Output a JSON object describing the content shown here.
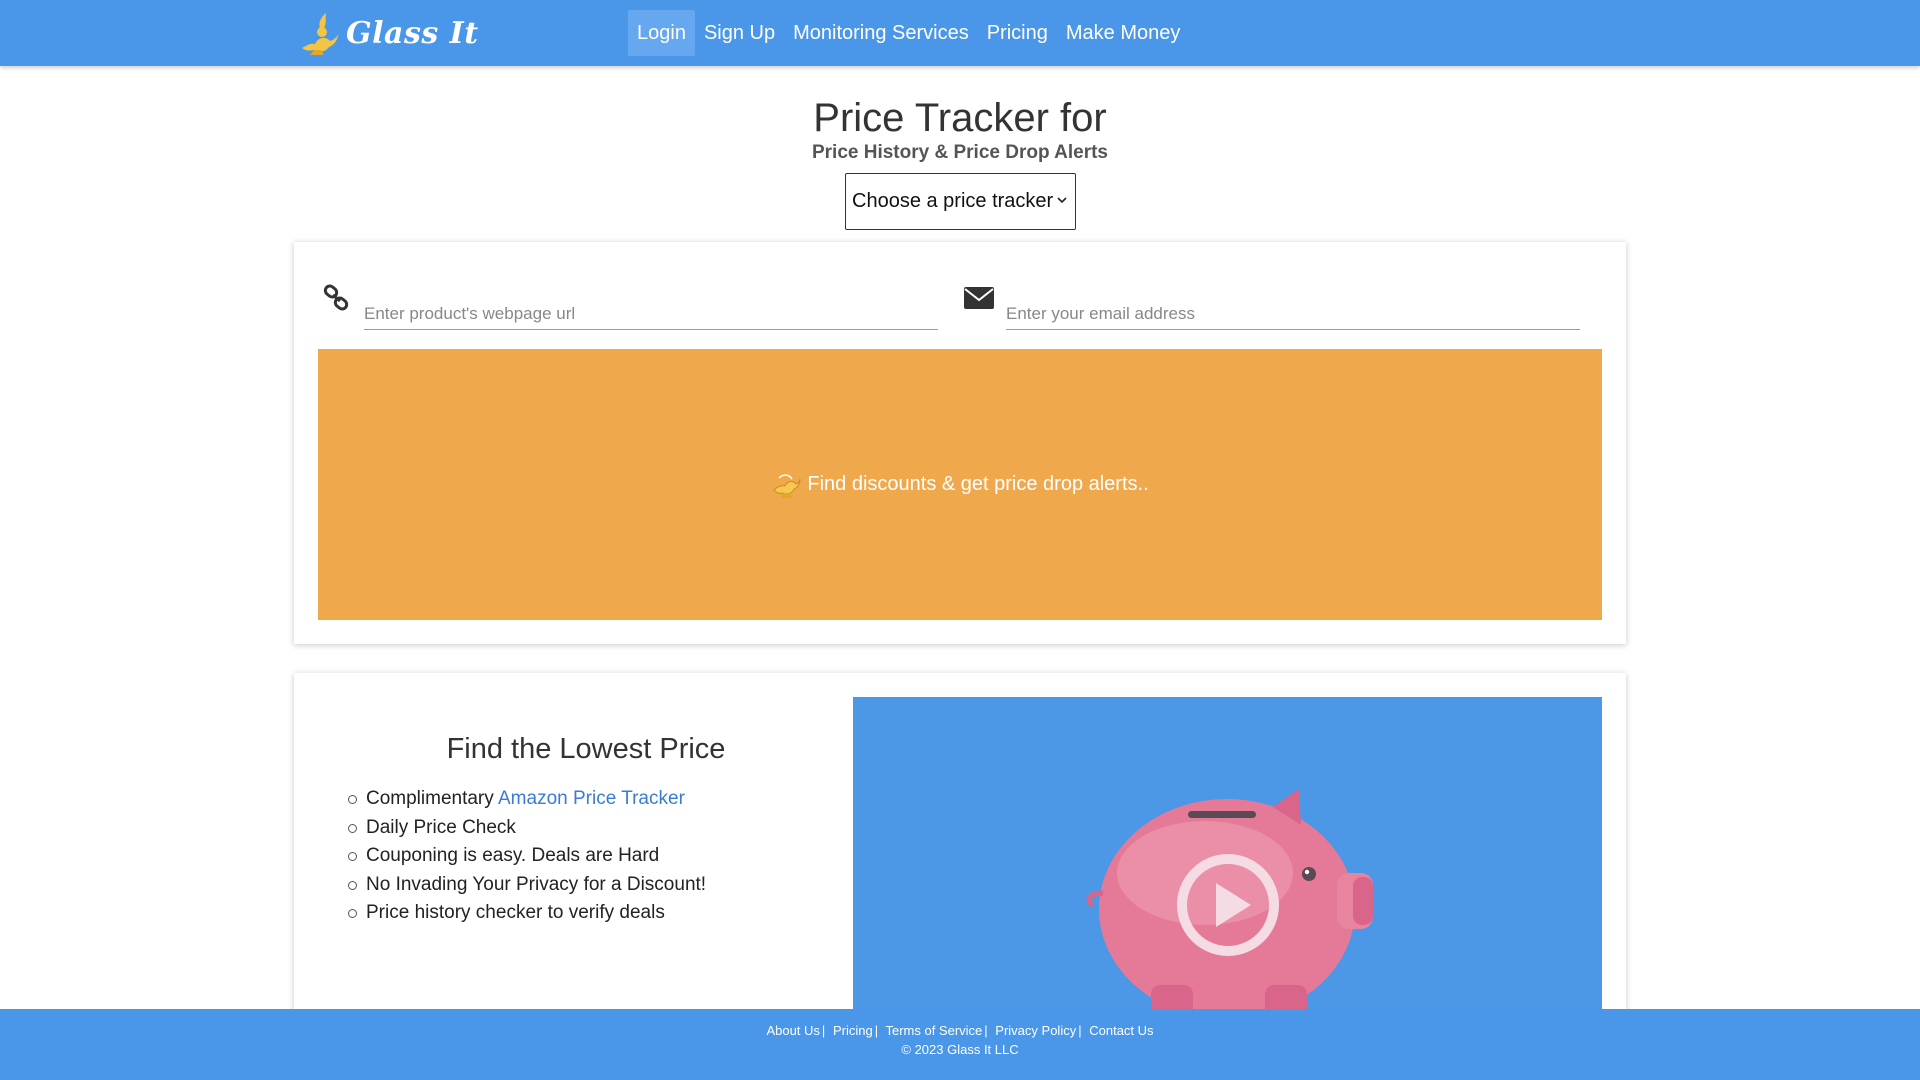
{
  "nav": {
    "brand": "Glass It",
    "links": [
      "Login",
      "Sign Up",
      "Monitoring Services",
      "Pricing",
      "Make Money"
    ],
    "active": "Login"
  },
  "hero": {
    "title": "Price Tracker for",
    "subtitle": "Price History & Price Drop Alerts",
    "select_value": "Choose a price tracker"
  },
  "form": {
    "url_placeholder": "Enter product's webpage url",
    "email_placeholder": "Enter your email address",
    "cta_label": "Find discounts & get price drop alerts.."
  },
  "features": {
    "title": "Find the Lowest Price",
    "items": [
      {
        "prefix": "Complimentary ",
        "link": "Amazon Price Tracker"
      },
      {
        "prefix": "Daily Price Check",
        "link": ""
      },
      {
        "prefix": "Couponing is easy. Deals are Hard",
        "link": ""
      },
      {
        "prefix": "No Invading Your Privacy for a Discount!",
        "link": ""
      },
      {
        "prefix": "Price history checker to verify deals",
        "link": ""
      }
    ]
  },
  "footer": {
    "links": [
      "About Us",
      "Pricing",
      "Terms of Service",
      "Privacy Policy",
      "Contact Us"
    ],
    "copyright": "© 2023 Glass It LLC"
  },
  "colors": {
    "nav_blue": "#4a96e8",
    "cta_orange": "#f0a84c",
    "video_blue": "#4c97e6",
    "piggy_pink": "#e57a98",
    "link_blue": "#3a7bd5"
  },
  "icons": {
    "brand": "genie-lamp-icon",
    "url_field": "link-icon",
    "email_field": "envelope-icon",
    "cta": "lamp-icon",
    "video": "play-icon"
  }
}
